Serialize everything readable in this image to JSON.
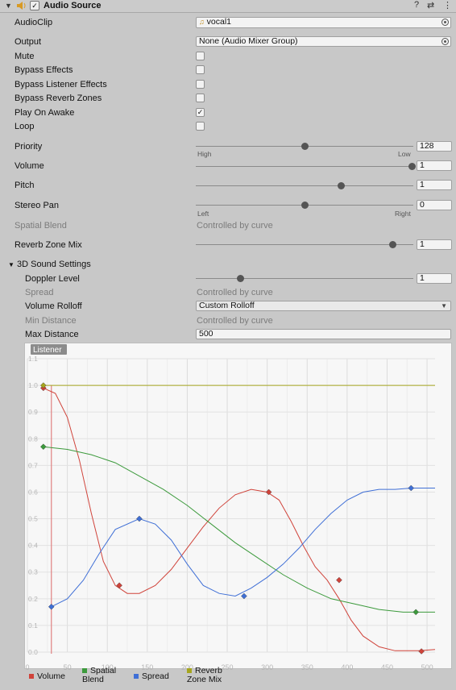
{
  "component": {
    "title": "Audio Source",
    "enabled_mark": "✓",
    "header_icons": [
      "help-icon",
      "preset-icon",
      "kebab-menu-icon"
    ],
    "help_glyph": "?",
    "preset_glyph": "⇄",
    "menu_glyph": "⋮"
  },
  "fields": {
    "audioclip": {
      "label": "AudioClip",
      "value": "vocal1"
    },
    "output": {
      "label": "Output",
      "value": "None (Audio Mixer Group)"
    },
    "mute": {
      "label": "Mute",
      "checked": false
    },
    "bypass_effects": {
      "label": "Bypass Effects",
      "checked": false
    },
    "bypass_listener": {
      "label": "Bypass Listener Effects",
      "checked": false
    },
    "bypass_reverb": {
      "label": "Bypass Reverb Zones",
      "checked": false
    },
    "play_on_awake": {
      "label": "Play On Awake",
      "checked": true,
      "mark": "✓"
    },
    "loop": {
      "label": "Loop",
      "checked": false
    },
    "priority": {
      "label": "Priority",
      "value": "128",
      "min_label": "High",
      "max_label": "Low",
      "level": 0.5
    },
    "volume": {
      "label": "Volume",
      "value": "1",
      "level": 1.0
    },
    "pitch": {
      "label": "Pitch",
      "value": "1",
      "level": 0.67
    },
    "stereo_pan": {
      "label": "Stereo Pan",
      "value": "0",
      "min_label": "Left",
      "max_label": "Right",
      "level": 0.5
    },
    "spatial_blend": {
      "label": "Spatial Blend",
      "value": "Controlled by curve"
    },
    "reverb_zone_mix": {
      "label": "Reverb Zone Mix",
      "value": "1",
      "level": 0.91
    }
  },
  "sound3d": {
    "label": "3D Sound Settings",
    "doppler": {
      "label": "Doppler Level",
      "value": "1",
      "level": 0.2
    },
    "spread": {
      "label": "Spread",
      "value": "Controlled by curve"
    },
    "rolloff": {
      "label": "Volume Rolloff",
      "value": "Custom Rolloff"
    },
    "min_distance": {
      "label": "Min Distance",
      "value": "Controlled by curve"
    },
    "max_distance": {
      "label": "Max Distance",
      "value": "500"
    }
  },
  "chart_data": {
    "type": "line",
    "listener_label": "Listener",
    "listener_x": 30,
    "xlim": [
      0,
      510
    ],
    "ylim": [
      0,
      1.1
    ],
    "x_ticks": [
      0,
      50,
      100,
      150,
      200,
      250,
      300,
      350,
      400,
      450,
      500
    ],
    "y_ticks": [
      0.0,
      0.1,
      0.2,
      0.3,
      0.4,
      0.5,
      0.6,
      0.7,
      0.8,
      0.9,
      1.0,
      1.1
    ],
    "grid": true,
    "legend_position": "bottom",
    "series": [
      {
        "name": "Volume",
        "color": "#d0433a",
        "curve": [
          [
            20,
            0.99
          ],
          [
            35,
            0.97
          ],
          [
            50,
            0.88
          ],
          [
            65,
            0.72
          ],
          [
            80,
            0.52
          ],
          [
            95,
            0.34
          ],
          [
            110,
            0.25
          ],
          [
            125,
            0.22
          ],
          [
            140,
            0.22
          ],
          [
            160,
            0.25
          ],
          [
            180,
            0.31
          ],
          [
            200,
            0.39
          ],
          [
            220,
            0.47
          ],
          [
            240,
            0.54
          ],
          [
            260,
            0.59
          ],
          [
            280,
            0.61
          ],
          [
            300,
            0.6
          ],
          [
            315,
            0.57
          ],
          [
            330,
            0.49
          ],
          [
            345,
            0.4
          ],
          [
            360,
            0.32
          ],
          [
            375,
            0.27
          ],
          [
            390,
            0.2
          ],
          [
            405,
            0.12
          ],
          [
            420,
            0.06
          ],
          [
            440,
            0.02
          ],
          [
            460,
            0.005
          ],
          [
            490,
            0.005
          ],
          [
            510,
            0.01
          ]
        ],
        "keys": [
          [
            20,
            0.99
          ],
          [
            115,
            0.25
          ],
          [
            302,
            0.6
          ],
          [
            390,
            0.27
          ],
          [
            493,
            0.003
          ]
        ]
      },
      {
        "name": "Spatial Blend",
        "color": "#3c9a3c",
        "curve": [
          [
            20,
            0.77
          ],
          [
            50,
            0.76
          ],
          [
            80,
            0.74
          ],
          [
            110,
            0.71
          ],
          [
            140,
            0.66
          ],
          [
            170,
            0.61
          ],
          [
            200,
            0.55
          ],
          [
            230,
            0.48
          ],
          [
            260,
            0.41
          ],
          [
            290,
            0.35
          ],
          [
            320,
            0.29
          ],
          [
            350,
            0.24
          ],
          [
            380,
            0.2
          ],
          [
            410,
            0.18
          ],
          [
            440,
            0.16
          ],
          [
            470,
            0.15
          ],
          [
            510,
            0.15
          ]
        ],
        "keys": [
          [
            20,
            0.77
          ],
          [
            486,
            0.15
          ]
        ]
      },
      {
        "name": "Spread",
        "color": "#3f6fd6",
        "curve": [
          [
            30,
            0.17
          ],
          [
            50,
            0.2
          ],
          [
            70,
            0.27
          ],
          [
            90,
            0.37
          ],
          [
            110,
            0.46
          ],
          [
            140,
            0.5
          ],
          [
            160,
            0.48
          ],
          [
            180,
            0.42
          ],
          [
            200,
            0.33
          ],
          [
            220,
            0.25
          ],
          [
            240,
            0.22
          ],
          [
            260,
            0.21
          ],
          [
            280,
            0.24
          ],
          [
            300,
            0.28
          ],
          [
            320,
            0.33
          ],
          [
            340,
            0.39
          ],
          [
            360,
            0.46
          ],
          [
            380,
            0.52
          ],
          [
            400,
            0.57
          ],
          [
            420,
            0.6
          ],
          [
            440,
            0.61
          ],
          [
            460,
            0.61
          ],
          [
            480,
            0.615
          ],
          [
            510,
            0.615
          ]
        ],
        "keys": [
          [
            30,
            0.17
          ],
          [
            140,
            0.5
          ],
          [
            271,
            0.21
          ],
          [
            480,
            0.615
          ]
        ]
      },
      {
        "name": "Reverb Zone Mix",
        "color": "#a5a51e",
        "curve": [
          [
            20,
            1.0
          ],
          [
            510,
            1.0
          ]
        ],
        "keys": [
          [
            20,
            1.0
          ]
        ]
      }
    ]
  }
}
